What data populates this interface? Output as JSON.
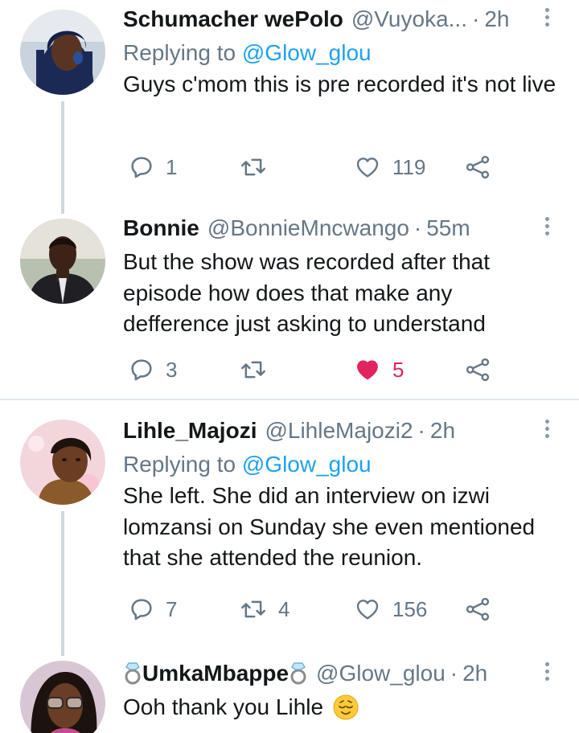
{
  "tweets": [
    {
      "name": "Schumacher wePolo",
      "handle": "@Vuyoka...",
      "separator": "·",
      "time": "2h",
      "replying_prefix": "Replying to",
      "replying_to": "@Glow_glou",
      "text": "Guys c'mom this is pre recorded it's not live",
      "replies": "1",
      "retweets": "",
      "likes": "119",
      "liked": false
    },
    {
      "name": "Bonnie",
      "handle": "@BonnieMncwango",
      "separator": "·",
      "time": "55m",
      "text": "But the show was recorded after that episode how does that make any defference just asking to understand",
      "replies": "3",
      "retweets": "",
      "likes": "5",
      "liked": true
    },
    {
      "name": "Lihle_Majozi",
      "handle": "@LihleMajozi2",
      "separator": "·",
      "time": "2h",
      "replying_prefix": "Replying to",
      "replying_to": "@Glow_glou",
      "text": "She left. She did an interview on izwi lomzansi on Sunday she even mentioned that she attended the reunion.",
      "replies": "7",
      "retweets": "4",
      "likes": "156",
      "liked": false
    },
    {
      "name": "UmkaMbappe",
      "name_decoration": "ring-emoji",
      "handle": "@Glow_glou",
      "separator": "·",
      "time": "2h",
      "text": "Ooh thank you Lihle",
      "text_emoji": "relieved-face-emoji"
    }
  ],
  "colors": {
    "accent": "#1da1f2",
    "like": "#e0245e",
    "secondary_text": "#657786",
    "thread_line": "#cfd9de"
  }
}
